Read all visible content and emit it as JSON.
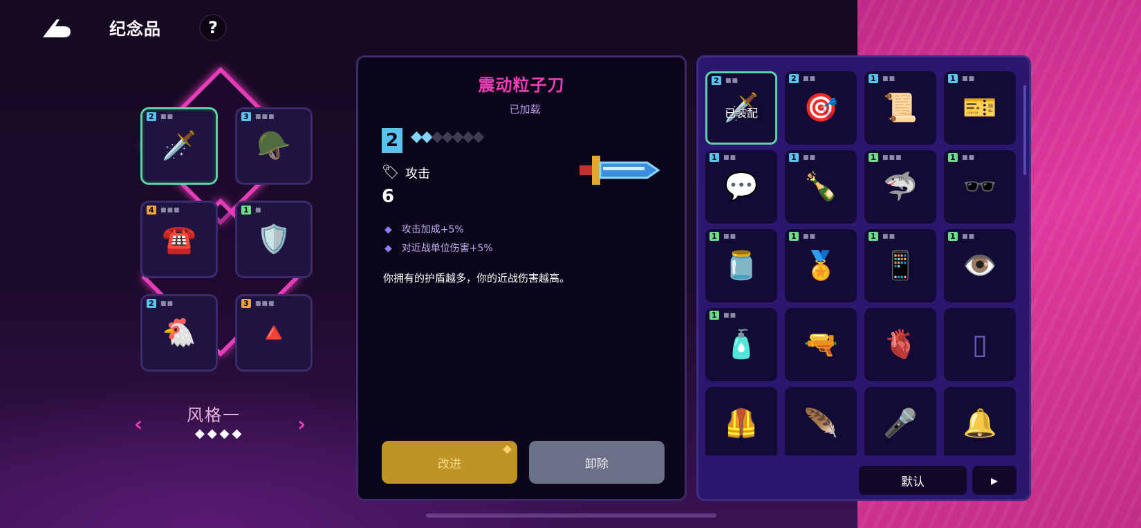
{
  "header": {
    "title": "纪念品",
    "help_label": "?"
  },
  "build": {
    "style_name": "风格一",
    "page_indicator": "◆◆◆◆",
    "slots": [
      {
        "level": "2",
        "level_color": "#59c4f0",
        "dots": "■■",
        "icon": "🗡️",
        "icon_name": "sword-icon",
        "selected": true
      },
      {
        "level": "3",
        "level_color": "#59c4f0",
        "dots": "■■■",
        "icon": "🪖",
        "icon_name": "helmet-icon"
      },
      {
        "level": "4",
        "level_color": "#f2a23a",
        "dots": "■■■",
        "icon": "☎️",
        "icon_name": "telephone-icon"
      },
      {
        "level": "1",
        "level_color": "#6fdc8c",
        "dots": "■",
        "icon": "🛡️",
        "icon_name": "shield-orb-icon"
      },
      {
        "level": "2",
        "level_color": "#59c4f0",
        "dots": "■■",
        "icon": "🐔",
        "icon_name": "chicken-mask-icon"
      },
      {
        "level": "3",
        "level_color": "#f2a23a",
        "dots": "■■■",
        "icon": "🔺",
        "icon_name": "triangle-amulet-icon"
      }
    ]
  },
  "detail": {
    "name": "震动粒子刀",
    "status": "已加载",
    "level": "2",
    "pips_on": "◆◆",
    "pips_off": "◆◆◆◆◆",
    "stat_label": "攻击",
    "stat_value": "6",
    "effects": [
      "攻击加成+5%",
      "对近战单位伤害+5%"
    ],
    "description": "你拥有的护盾越多，你的近战伤害越高。",
    "upgrade_label": "改进",
    "remove_label": "卸除"
  },
  "inventory": {
    "equipped_label": "已装配",
    "items": [
      {
        "level": "2",
        "level_color": "#59c4f0",
        "dots": "■■",
        "icon": "🗡️",
        "icon_name": "sword-icon",
        "selected": true,
        "equipped": true
      },
      {
        "level": "2",
        "level_color": "#59c4f0",
        "dots": "■■",
        "icon": "🎯",
        "icon_name": "red-gadget-icon"
      },
      {
        "level": "1",
        "level_color": "#59c4f0",
        "dots": "■■",
        "icon": "📜",
        "icon_name": "scroll-icon"
      },
      {
        "level": "1",
        "level_color": "#59c4f0",
        "dots": "■■",
        "icon": "🎫",
        "icon_name": "ticket-icon"
      },
      {
        "level": "1",
        "level_color": "#59c4f0",
        "dots": "■■",
        "icon": "💬",
        "icon_name": "chat-card-icon"
      },
      {
        "level": "1",
        "level_color": "#59c4f0",
        "dots": "■■",
        "icon": "🍾",
        "icon_name": "bottle-icon"
      },
      {
        "level": "1",
        "level_color": "#6fdc8c",
        "dots": "■■■",
        "icon": "🦈",
        "icon_name": "shark-icon"
      },
      {
        "level": "1",
        "level_color": "#6fdc8c",
        "dots": "■■",
        "icon": "🕶️",
        "icon_name": "sunglasses-icon"
      },
      {
        "level": "1",
        "level_color": "#6fdc8c",
        "dots": "■■",
        "icon": "🫙",
        "icon_name": "jar-icon"
      },
      {
        "level": "1",
        "level_color": "#6fdc8c",
        "dots": "■■",
        "icon": "🏅",
        "icon_name": "medal-icon"
      },
      {
        "level": "1",
        "level_color": "#6fdc8c",
        "dots": "■■",
        "icon": "📱",
        "icon_name": "phone-icon"
      },
      {
        "level": "1",
        "level_color": "#6fdc8c",
        "dots": "■■",
        "icon": "👁️",
        "icon_name": "eye-creature-icon"
      },
      {
        "level": "1",
        "level_color": "#6fdc8c",
        "dots": "■■",
        "icon": "🧴",
        "icon_name": "milk-bottle-icon"
      },
      {
        "level": "",
        "icon": "🔫",
        "icon_name": "locked-blaster-icon",
        "locked": true
      },
      {
        "level": "",
        "icon": "🫀",
        "icon_name": "locked-heart-icon",
        "locked": true
      },
      {
        "level": "",
        "icon": "▯",
        "icon_name": "locked-card-icon",
        "locked": true
      },
      {
        "level": "",
        "icon": "🦺",
        "icon_name": "locked-vest-icon",
        "locked": true
      },
      {
        "level": "",
        "icon": "🪶",
        "icon_name": "locked-feather-icon",
        "locked": true
      },
      {
        "level": "",
        "icon": "🎤",
        "icon_name": "locked-mic-icon",
        "locked": true
      },
      {
        "level": "",
        "icon": "🔔",
        "icon_name": "locked-bell-icon",
        "locked": true
      }
    ],
    "default_label": "默认",
    "sort_label": "▸"
  }
}
